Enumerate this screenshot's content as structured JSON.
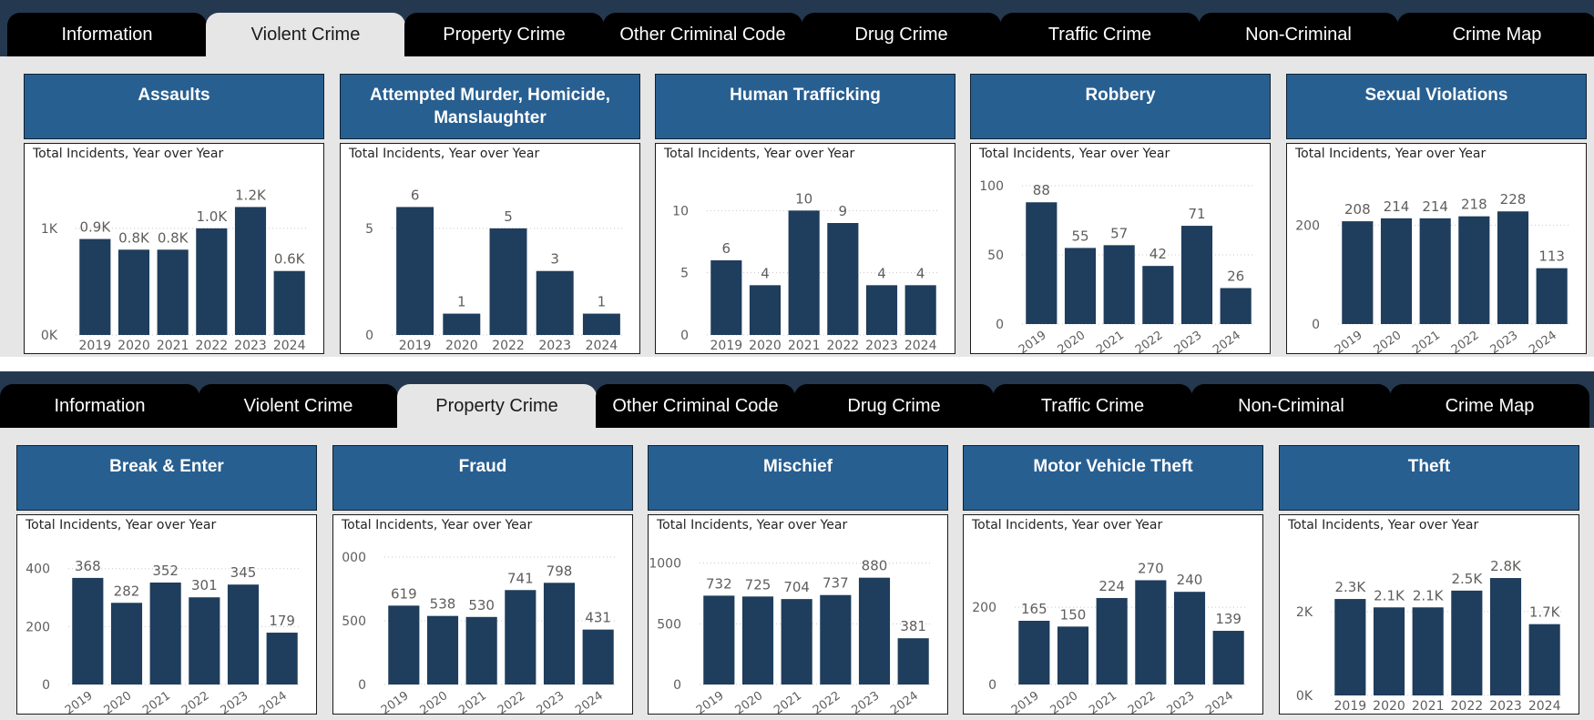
{
  "dashboards": [
    {
      "tabs": [
        "Information",
        "Violent Crime",
        "Property Crime",
        "Other Criminal Code",
        "Drug Crime",
        "Traffic Crime",
        "Non-Criminal",
        "Crime Map"
      ],
      "active_tab": 1,
      "cards": [
        {
          "title": "Assaults",
          "subtitle": "Total Incidents, Year over Year"
        },
        {
          "title": "Attempted Murder, Homicide, Manslaughter",
          "subtitle": "Total Incidents, Year over Year"
        },
        {
          "title": "Human Trafficking",
          "subtitle": "Total Incidents, Year over Year"
        },
        {
          "title": "Robbery",
          "subtitle": "Total Incidents, Year over Year"
        },
        {
          "title": "Sexual Violations",
          "subtitle": "Total Incidents, Year over Year"
        }
      ]
    },
    {
      "tabs": [
        "Information",
        "Violent Crime",
        "Property Crime",
        "Other Criminal Code",
        "Drug Crime",
        "Traffic Crime",
        "Non-Criminal",
        "Crime Map"
      ],
      "active_tab": 2,
      "cards": [
        {
          "title": "Break & Enter",
          "subtitle": "Total Incidents, Year over Year"
        },
        {
          "title": "Fraud",
          "subtitle": "Total Incidents, Year over Year"
        },
        {
          "title": "Mischief",
          "subtitle": "Total Incidents, Year over Year"
        },
        {
          "title": "Motor Vehicle Theft",
          "subtitle": "Total Incidents, Year over Year"
        },
        {
          "title": "Theft",
          "subtitle": "Total Incidents, Year over Year"
        }
      ]
    }
  ],
  "colors": {
    "bar": "#1f3d5c",
    "header": "#285f91",
    "tab_bar": "#24394f",
    "tab": "#000000",
    "tab_active": "#e6e6e6",
    "canvas": "#e6e6e6"
  },
  "chart_data": [
    {
      "type": "bar",
      "title": "Assaults",
      "categories": [
        "2019",
        "2020",
        "2021",
        "2022",
        "2023",
        "2024"
      ],
      "values": [
        900,
        800,
        800,
        1000,
        1200,
        600
      ],
      "data_labels": [
        "0.9K",
        "0.8K",
        "0.8K",
        "1.0K",
        "1.2K",
        "0.6K"
      ],
      "ylim": [
        0,
        1400
      ],
      "yticks": [
        0,
        1000
      ],
      "ytick_labels": [
        "0K",
        "1K"
      ],
      "x_rotated": false
    },
    {
      "type": "bar",
      "title": "Attempted Murder, Homicide, Manslaughter",
      "categories": [
        "2019",
        "2020",
        "2022",
        "2023",
        "2024"
      ],
      "values": [
        6,
        1,
        5,
        3,
        1
      ],
      "data_labels": [
        "6",
        "1",
        "5",
        "3",
        "1"
      ],
      "ylim": [
        0,
        7
      ],
      "yticks": [
        0,
        5
      ],
      "ytick_labels": [
        "0",
        "5"
      ],
      "x_rotated": false
    },
    {
      "type": "bar",
      "title": "Human Trafficking",
      "categories": [
        "2019",
        "2020",
        "2021",
        "2022",
        "2023",
        "2024"
      ],
      "values": [
        6,
        4,
        10,
        9,
        4,
        4
      ],
      "data_labels": [
        "6",
        "4",
        "10",
        "9",
        "4",
        "4"
      ],
      "ylim": [
        0,
        12
      ],
      "yticks": [
        0,
        5,
        10
      ],
      "ytick_labels": [
        "0",
        "5",
        "10"
      ],
      "x_rotated": false
    },
    {
      "type": "bar",
      "title": "Robbery",
      "categories": [
        "2019",
        "2020",
        "2021",
        "2022",
        "2023",
        "2024"
      ],
      "values": [
        88,
        55,
        57,
        42,
        71,
        26
      ],
      "data_labels": [
        "88",
        "55",
        "57",
        "42",
        "71",
        "26"
      ],
      "ylim": [
        0,
        100
      ],
      "yticks": [
        0,
        50,
        100
      ],
      "ytick_labels": [
        "0",
        "50",
        "100"
      ],
      "x_rotated": true
    },
    {
      "type": "bar",
      "title": "Sexual Violations",
      "categories": [
        "2019",
        "2020",
        "2021",
        "2022",
        "2023",
        "2024"
      ],
      "values": [
        208,
        214,
        214,
        218,
        228,
        113
      ],
      "data_labels": [
        "208",
        "214",
        "214",
        "218",
        "228",
        "113"
      ],
      "ylim": [
        0,
        280
      ],
      "yticks": [
        0,
        200
      ],
      "ytick_labels": [
        "0",
        "200"
      ],
      "x_rotated": true
    },
    {
      "type": "bar",
      "title": "Break & Enter",
      "categories": [
        "2019",
        "2020",
        "2021",
        "2022",
        "2023",
        "2024"
      ],
      "values": [
        368,
        282,
        352,
        301,
        345,
        179
      ],
      "data_labels": [
        "368",
        "282",
        "352",
        "301",
        "345",
        "179"
      ],
      "ylim": [
        0,
        440
      ],
      "yticks": [
        0,
        200,
        400
      ],
      "ytick_labels": [
        "0",
        "200",
        "400"
      ],
      "x_rotated": true
    },
    {
      "type": "bar",
      "title": "Fraud",
      "categories": [
        "2019",
        "2020",
        "2021",
        "2022",
        "2023",
        "2024"
      ],
      "values": [
        619,
        538,
        530,
        741,
        798,
        431
      ],
      "data_labels": [
        "619",
        "538",
        "530",
        "741",
        "798",
        "431"
      ],
      "ylim": [
        0,
        1000
      ],
      "yticks": [
        0,
        500,
        1000
      ],
      "ytick_labels": [
        "0",
        "500",
        "000"
      ],
      "x_rotated": true
    },
    {
      "type": "bar",
      "title": "Mischief",
      "categories": [
        "2019",
        "2020",
        "2021",
        "2022",
        "2023",
        "2024"
      ],
      "values": [
        732,
        725,
        704,
        737,
        880,
        381
      ],
      "data_labels": [
        "732",
        "725",
        "704",
        "737",
        "880",
        "381"
      ],
      "ylim": [
        0,
        1050
      ],
      "yticks": [
        0,
        500,
        1000
      ],
      "ytick_labels": [
        "0",
        "500",
        "1000"
      ],
      "x_rotated": true
    },
    {
      "type": "bar",
      "title": "Motor Vehicle Theft",
      "categories": [
        "2019",
        "2020",
        "2021",
        "2022",
        "2023",
        "2024"
      ],
      "values": [
        165,
        150,
        224,
        270,
        240,
        139
      ],
      "data_labels": [
        "165",
        "150",
        "224",
        "270",
        "240",
        "139"
      ],
      "ylim": [
        0,
        330
      ],
      "yticks": [
        0,
        200
      ],
      "ytick_labels": [
        "0",
        "200"
      ],
      "x_rotated": true
    },
    {
      "type": "bar",
      "title": "Theft",
      "categories": [
        "2019",
        "2020",
        "2021",
        "2022",
        "2023",
        "2024"
      ],
      "values": [
        2300,
        2100,
        2100,
        2500,
        2800,
        1700
      ],
      "data_labels": [
        "2.3K",
        "2.1K",
        "2.1K",
        "2.5K",
        "2.8K",
        "1.7K"
      ],
      "ylim": [
        0,
        3300
      ],
      "yticks": [
        0,
        2000
      ],
      "ytick_labels": [
        "0K",
        "2K"
      ],
      "x_rotated": false
    }
  ]
}
